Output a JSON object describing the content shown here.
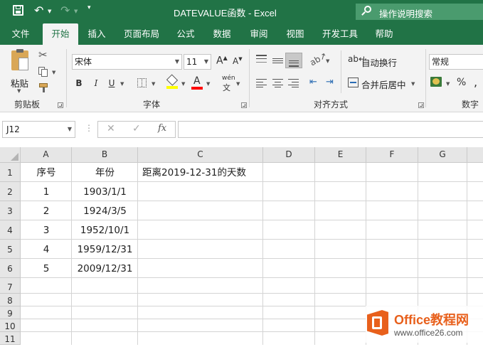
{
  "title": {
    "text": "DATEVALUE函数  -  Excel"
  },
  "search": {
    "placeholder": "操作说明搜索"
  },
  "tabs": [
    "文件",
    "开始",
    "插入",
    "页面布局",
    "公式",
    "数据",
    "审阅",
    "视图",
    "开发工具",
    "帮助"
  ],
  "active_tab": "开始",
  "clipboard": {
    "paste": "粘贴",
    "group": "剪贴板"
  },
  "font": {
    "name": "宋体",
    "size": "11",
    "group": "字体",
    "bold": "B",
    "italic": "I",
    "underline": "U",
    "phonetic": "wén"
  },
  "alignment": {
    "wrap": "自动换行",
    "merge": "合并后居中",
    "group": "对齐方式"
  },
  "number": {
    "format": "常规",
    "percent": "%",
    "group": "数字"
  },
  "formula_bar": {
    "name_box": "J12",
    "fx": "fx",
    "content": ""
  },
  "columns": [
    "A",
    "B",
    "C",
    "D",
    "E",
    "F",
    "G"
  ],
  "rows": [
    "1",
    "2",
    "3",
    "4",
    "5",
    "6",
    "7",
    "8",
    "9",
    "10",
    "11"
  ],
  "cells": {
    "A1": "序号",
    "B1": "年份",
    "C1": "距离2019-12-31的天数",
    "A2": "1",
    "B2": "1903/1/1",
    "A3": "2",
    "B3": "1924/3/5",
    "A4": "3",
    "B4": "1952/10/1",
    "A5": "4",
    "B5": "1959/12/31",
    "A6": "5",
    "B6": "2009/12/31"
  },
  "watermark": {
    "brand": "Office教程网",
    "url": "www.office26.com"
  },
  "colors": {
    "accent": "#217346",
    "watermark_orange": "#e8601c"
  }
}
